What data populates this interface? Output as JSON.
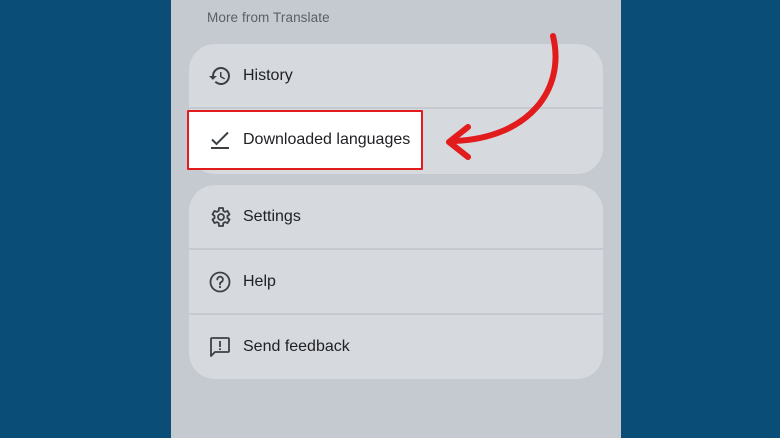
{
  "menu": {
    "section_label": "More from Translate",
    "group1": [
      {
        "label": "History",
        "icon": "history-icon"
      },
      {
        "label": "Downloaded languages",
        "icon": "download-check-icon"
      }
    ],
    "group2": [
      {
        "label": "Settings",
        "icon": "gear-icon"
      },
      {
        "label": "Help",
        "icon": "help-icon"
      },
      {
        "label": "Send feedback",
        "icon": "feedback-icon"
      }
    ]
  },
  "annotation": {
    "highlight_color": "#e21c1c",
    "highlighted_item": "Downloaded languages"
  },
  "colors": {
    "background": "#0a4e78",
    "panel": "#c5c9d0",
    "card": "#d6d9de",
    "text": "#202124",
    "section_text": "#5b5f66"
  }
}
